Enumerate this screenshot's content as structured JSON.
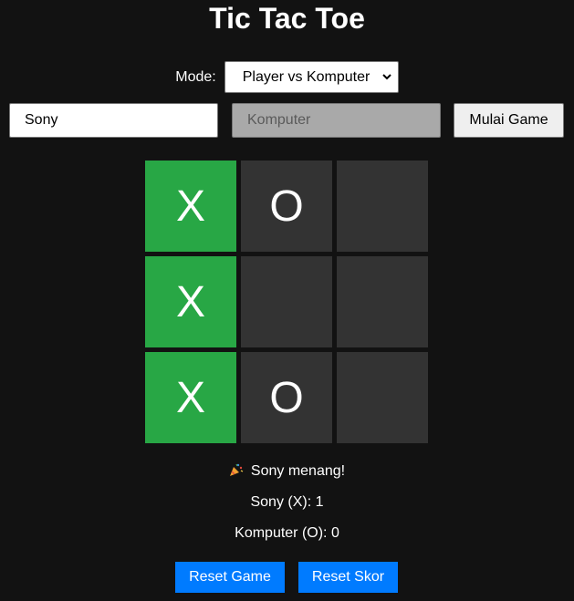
{
  "title": "Tic Tac Toe",
  "mode": {
    "label": "Mode:",
    "selected": "Player vs Komputer"
  },
  "players": {
    "p1_value": "Sony",
    "p2_value": "Komputer"
  },
  "start_button": "Mulai Game",
  "board": [
    {
      "mark": "X",
      "winning": true
    },
    {
      "mark": "O",
      "winning": false
    },
    {
      "mark": "",
      "winning": false
    },
    {
      "mark": "X",
      "winning": true
    },
    {
      "mark": "",
      "winning": false
    },
    {
      "mark": "",
      "winning": false
    },
    {
      "mark": "X",
      "winning": true
    },
    {
      "mark": "O",
      "winning": false
    },
    {
      "mark": "",
      "winning": false
    }
  ],
  "status": {
    "icon": "party-popper-icon",
    "text": "Sony menang!"
  },
  "scores": {
    "p1": "Sony (X): 1",
    "p2": "Komputer (O): 0"
  },
  "buttons": {
    "reset_game": "Reset Game",
    "reset_score": "Reset Skor"
  },
  "colors": {
    "background": "#121212",
    "cell": "#333333",
    "win_cell": "#28a745",
    "button_accent": "#007bff"
  }
}
